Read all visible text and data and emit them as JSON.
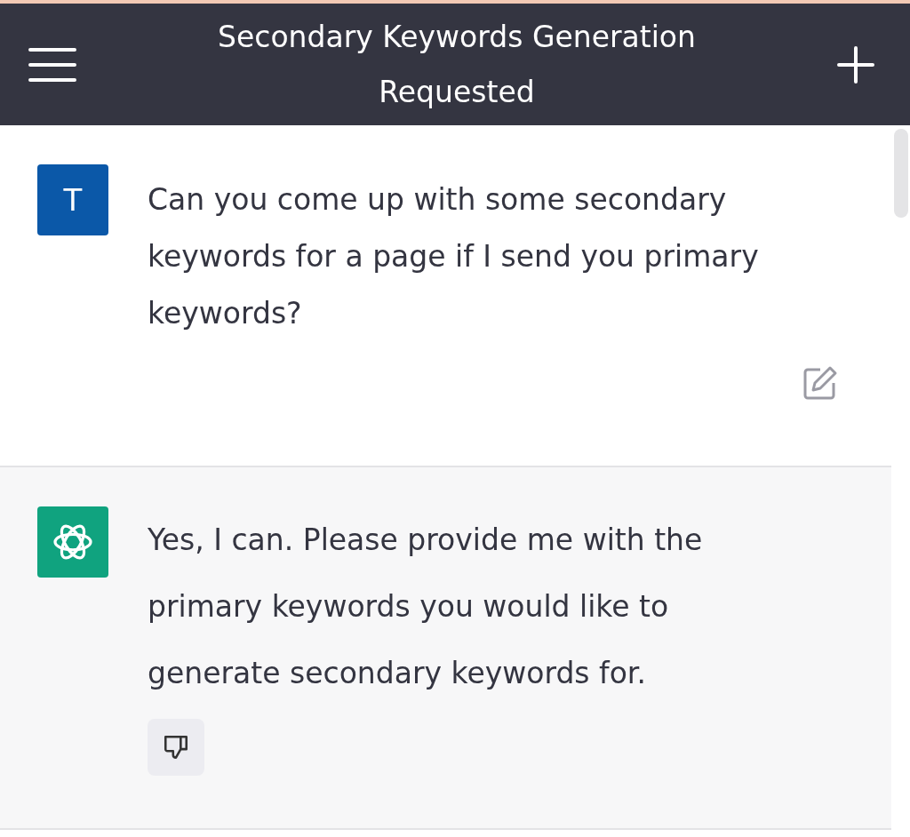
{
  "header": {
    "title": "Secondary Keywords Generation Requested"
  },
  "messages": [
    {
      "kind": "user",
      "avatar": "T",
      "text": "Can you come up with some secondary keywords for a page if I send you primary keywords?"
    },
    {
      "kind": "assistant",
      "text": "Yes, I can. Please provide me with the primary keywords you would like to generate secondary keywords for."
    }
  ]
}
